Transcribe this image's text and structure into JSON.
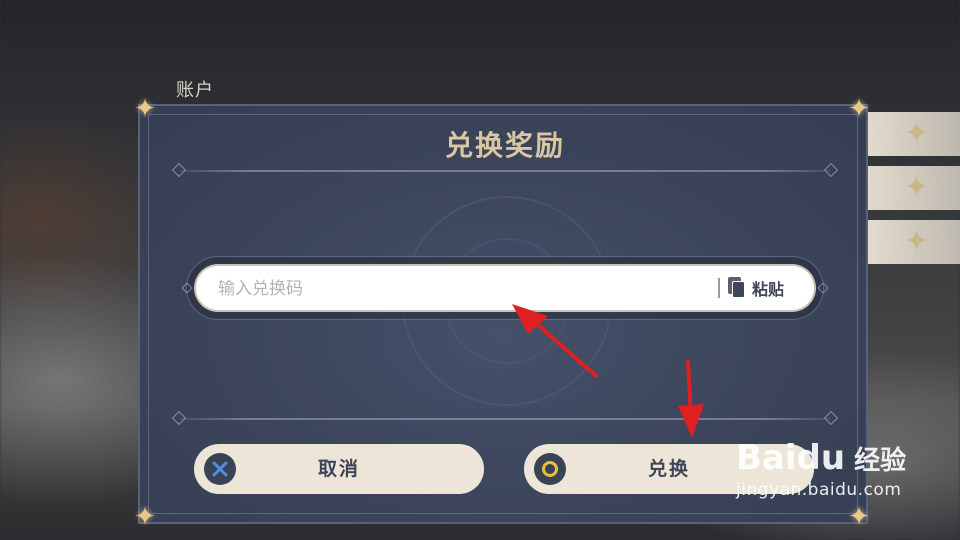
{
  "background": {
    "account_label": "账户"
  },
  "dialog": {
    "title": "兑换奖励",
    "input": {
      "placeholder": "输入兑换码",
      "value": ""
    },
    "paste_label": "粘贴",
    "cancel_label": "取消",
    "confirm_label": "兑换"
  },
  "icons": {
    "paste": "clipboard-icon",
    "cancel": "x-circle-icon",
    "confirm": "o-circle-icon",
    "corner": "star-ornament-icon"
  },
  "colors": {
    "dialog_bg": "#3b4459",
    "title": "#d9c7a2",
    "button_bg": "#ece5d8",
    "button_text": "#3e4556",
    "cancel_x": "#4f8fe0",
    "confirm_o": "#e6bf3a",
    "annotation_arrow": "#e02020"
  },
  "watermark": {
    "brand": "Baidu",
    "brand_cn": "经验",
    "url": "jingyan.baidu.com"
  }
}
